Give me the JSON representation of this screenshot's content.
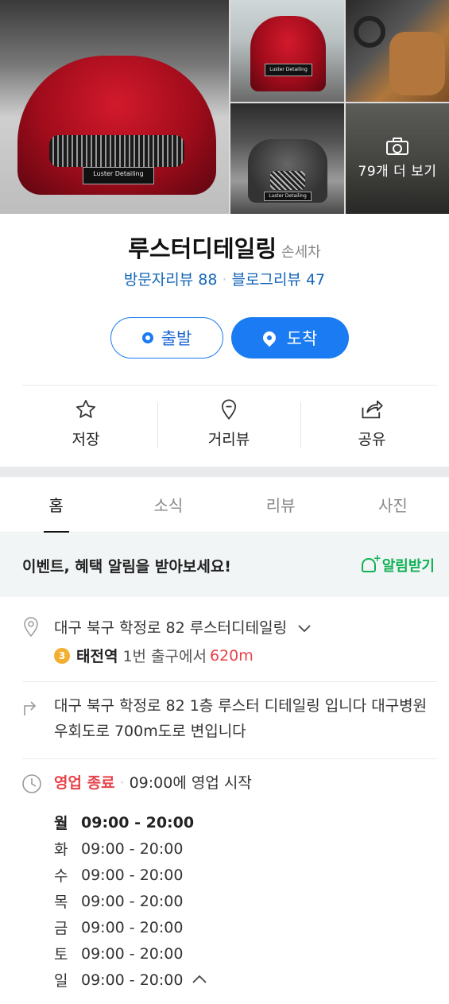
{
  "photos": {
    "more_label": "79개 더 보기",
    "plate_text": "Luster Detailing"
  },
  "place": {
    "name": "루스터디테일링",
    "category": "손세차",
    "visitor_reviews": "방문자리뷰 88",
    "blog_reviews": "블로그리뷰 47"
  },
  "route": {
    "depart_label": "출발",
    "arrive_label": "도착"
  },
  "actions": {
    "save_label": "저장",
    "street_label": "거리뷰",
    "share_label": "공유"
  },
  "tabs": [
    "홈",
    "소식",
    "리뷰",
    "사진"
  ],
  "notice": {
    "message": "이벤트, 혜택 알림을 받아보세요!",
    "subscribe_label": "알림받기"
  },
  "address": {
    "text": "대구 북구 학정로 82 루스터디테일링",
    "station_line": "3",
    "station_name": "태전역",
    "exit_text": "1번 출구에서",
    "distance": "620m"
  },
  "directions": {
    "text": "대구 북구 학정로 82 1층 루스터 디테일링 입니다 대구병원 우회도로 700m도로 변입니다"
  },
  "hours": {
    "status": "영업 종료",
    "next_open": "09:00에 영업 시작",
    "week": [
      {
        "day": "월",
        "time": "09:00 - 20:00"
      },
      {
        "day": "화",
        "time": "09:00 - 20:00"
      },
      {
        "day": "수",
        "time": "09:00 - 20:00"
      },
      {
        "day": "목",
        "time": "09:00 - 20:00"
      },
      {
        "day": "금",
        "time": "09:00 - 20:00"
      },
      {
        "day": "토",
        "time": "09:00 - 20:00"
      },
      {
        "day": "일",
        "time": "09:00 - 20:00"
      }
    ]
  },
  "colors": {
    "link_blue": "#1466b8",
    "primary_blue": "#1a7bf2",
    "closed_red": "#e8424a",
    "green": "#10b155"
  }
}
